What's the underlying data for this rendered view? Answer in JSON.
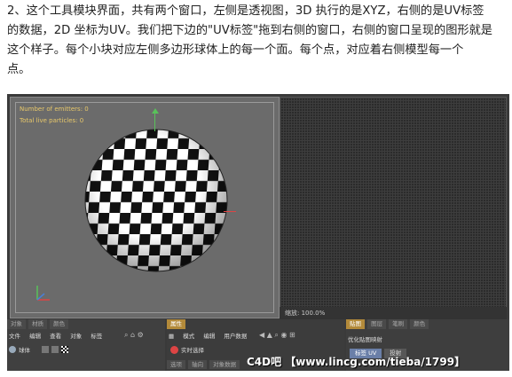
{
  "intro": {
    "line1": "2、这个工具模块界面，共有两个窗口，左侧是透视图，3D 执行的是XYZ，右侧的是UV标签",
    "line2": "的数据，2D 坐标为UV。我们把下边的\"UV标签\"拖到右侧的窗口，右侧的窗口呈现的图形就是",
    "line3": "这个样子。每个小块对应左侧多边形球体上的每一个面。每个点，对应着右侧模型每一个",
    "line4": "点。"
  },
  "viewport_left": {
    "hud_emitters": "Number of emitters: 0",
    "hud_particles": "Total live particles: 0"
  },
  "viewport_right": {
    "zoom_label": "缩放: 100.0%"
  },
  "object_manager": {
    "tabs": [
      "对象",
      "材质",
      "颜色"
    ],
    "menu": [
      "文件",
      "编辑",
      "查看",
      "对象",
      "标签"
    ],
    "object_name": "球体"
  },
  "attribute_manager": {
    "tab": "属性",
    "menu": [
      "模式",
      "编辑",
      "用户数据"
    ],
    "record_label": "实时选择",
    "bottom_tabs": [
      "选项",
      "轴向",
      "对象数据"
    ]
  },
  "uv_panel": {
    "tabs": [
      "贴图",
      "图层",
      "笔刷",
      "颜色"
    ],
    "optimize_label": "优化贴图映射",
    "buttons": [
      "标签 UV",
      "投射"
    ]
  },
  "watermark": {
    "text": "C4D吧 【www.lincg.com/tieba/1799】"
  },
  "colors": {
    "accent_tab": "#b38a3a",
    "hud_text": "#e8c86a",
    "y_axis": "#59c25a",
    "x_axis": "#dd4444"
  }
}
